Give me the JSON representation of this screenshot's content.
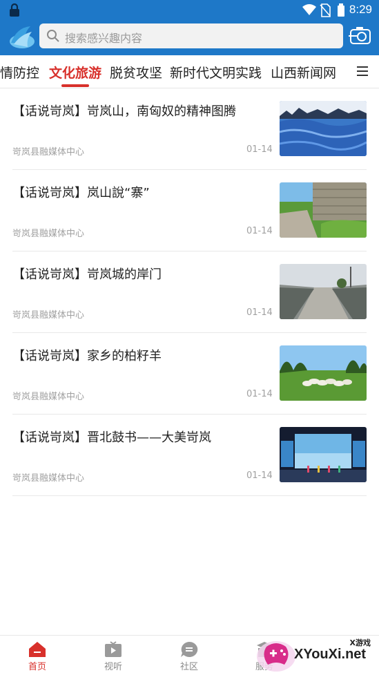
{
  "status_bar": {
    "time": "8:29"
  },
  "search": {
    "placeholder": "搜索感兴趣内容"
  },
  "tabs": [
    {
      "label": "疫情防控",
      "visible_label": "情防控",
      "active": false
    },
    {
      "label": "文化旅游",
      "active": true
    },
    {
      "label": "脱贫攻坚",
      "active": false
    },
    {
      "label": "新时代文明实践",
      "active": false
    },
    {
      "label": "山西新闻网",
      "active": false
    }
  ],
  "articles": [
    {
      "title": "【话说岢岚】岢岚山，南匈奴的精神图腾",
      "source": "岢岚县融媒体中心",
      "date": "01-14",
      "thumb": "snowy-mountain"
    },
    {
      "title": "【话说岢岚】岚山說“寨”",
      "source": "岢岚县融媒体中心",
      "date": "01-14",
      "thumb": "stone-wall-grass"
    },
    {
      "title": "【话说岢岚】岢岚城的岸门",
      "source": "岢岚县融媒体中心",
      "date": "01-14",
      "thumb": "bridge-road"
    },
    {
      "title": "【话说岢岚】家乡的柏籽羊",
      "source": "岢岚县融媒体中心",
      "date": "01-14",
      "thumb": "sheep-meadow"
    },
    {
      "title": "【话说岢岚】晋北鼓书——大美岢岚",
      "source": "岢岚县融媒体中心",
      "date": "01-14",
      "thumb": "stage-performance"
    }
  ],
  "bottom_nav": [
    {
      "label": "首页",
      "icon": "home-icon",
      "active": true
    },
    {
      "label": "视听",
      "icon": "tv-icon",
      "active": false
    },
    {
      "label": "社区",
      "icon": "chat-icon",
      "active": false
    },
    {
      "label": "服务",
      "icon": "service-icon",
      "active": false
    }
  ],
  "watermark": {
    "text": "XYouXi.net",
    "cn": "X游戏"
  },
  "colors": {
    "brand_blue": "#1e78c8",
    "accent_red": "#d8302b"
  }
}
